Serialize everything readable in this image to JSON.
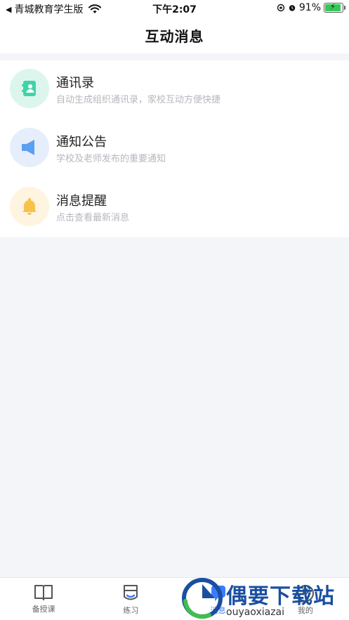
{
  "status_bar": {
    "back_app": "青城教育学生版",
    "time": "下午2:07",
    "battery": "91%"
  },
  "header": {
    "title": "互动消息"
  },
  "items": [
    {
      "title": "通讯录",
      "subtitle": "自动生成组织通讯录，家校互动方便快捷",
      "icon": "contacts-icon",
      "bg": "#dcf6ee",
      "fg": "#41d3a7"
    },
    {
      "title": "通知公告",
      "subtitle": "学校及老师发布的重要通知",
      "icon": "speaker-icon",
      "bg": "#e6eefb",
      "fg": "#5aa0f3"
    },
    {
      "title": "消息提醒",
      "subtitle": "点击查看最新消息",
      "icon": "bell-icon",
      "bg": "#fff4e0",
      "fg": "#f6c24a"
    }
  ],
  "nav": [
    {
      "label": "备授课",
      "icon": "book-icon"
    },
    {
      "label": "练习",
      "icon": "practice-icon"
    },
    {
      "label": "消息",
      "icon": "message-icon",
      "active": true
    },
    {
      "label": "我的",
      "icon": "profile-icon"
    }
  ],
  "watermark": {
    "cn": "偶要下载站",
    "en": "ouyaoxiazai"
  }
}
